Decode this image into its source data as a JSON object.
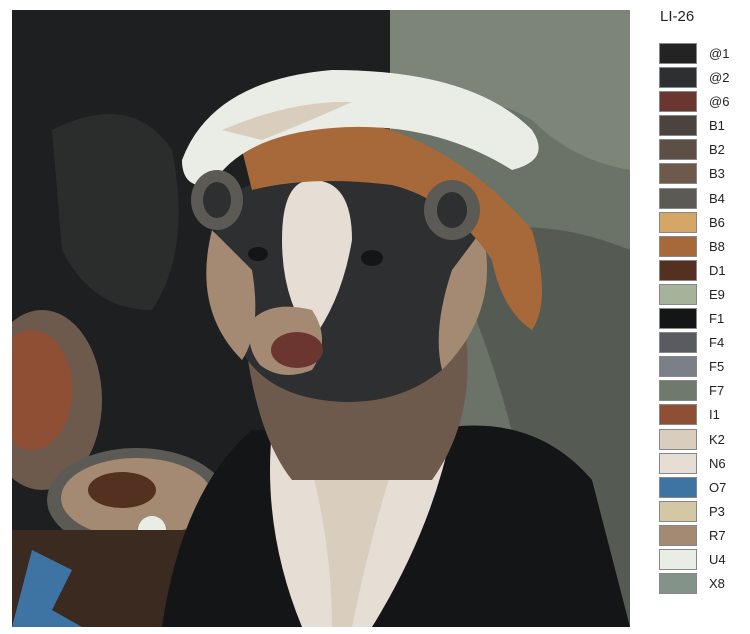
{
  "code": "LI-26",
  "legend": [
    {
      "label": "@1",
      "color": "#232323"
    },
    {
      "label": "@2",
      "color": "#2e2f31"
    },
    {
      "label": "@6",
      "color": "#6b3530"
    },
    {
      "label": "B1",
      "color": "#4a4340"
    },
    {
      "label": "B2",
      "color": "#5d4f46"
    },
    {
      "label": "B3",
      "color": "#6e5a4c"
    },
    {
      "label": "B4",
      "color": "#5c5a55"
    },
    {
      "label": "B6",
      "color": "#d4a766"
    },
    {
      "label": "B8",
      "color": "#a8693a"
    },
    {
      "label": "D1",
      "color": "#53301f"
    },
    {
      "label": "E9",
      "color": "#a4b399"
    },
    {
      "label": "F1",
      "color": "#141517"
    },
    {
      "label": "F4",
      "color": "#5a5b60"
    },
    {
      "label": "F5",
      "color": "#7b7f87"
    },
    {
      "label": "F7",
      "color": "#6f7a6c"
    },
    {
      "label": "I1",
      "color": "#8e4f34"
    },
    {
      "label": "K2",
      "color": "#d9cdbd"
    },
    {
      "label": "N6",
      "color": "#e6ddd4"
    },
    {
      "label": "O7",
      "color": "#3e74a4"
    },
    {
      "label": "P3",
      "color": "#d4c8a4"
    },
    {
      "label": "R7",
      "color": "#a48a72"
    },
    {
      "label": "U4",
      "color": "#eaede6"
    },
    {
      "label": "X8",
      "color": "#849389"
    }
  ]
}
